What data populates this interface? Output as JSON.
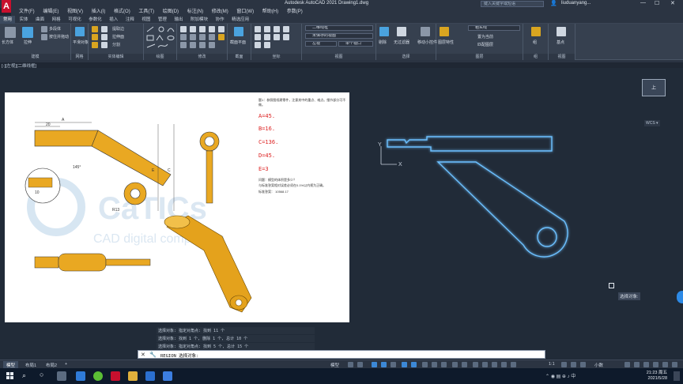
{
  "titlebar": {
    "app_title": "Autodesk AutoCAD 2021     Drawing1.dwg",
    "search_placeholder": "键入关键字或短语",
    "user": "liuduanyang...",
    "min": "—",
    "max": "☐",
    "close": "✕"
  },
  "menu": [
    "文件(F)",
    "编辑(E)",
    "视图(V)",
    "插入(I)",
    "格式(O)",
    "工具(T)",
    "绘图(D)",
    "标注(N)",
    "修改(M)",
    "窗口(W)",
    "帮助(H)",
    "参数(P)"
  ],
  "ribbon_tabs": [
    "常用",
    "实体",
    "曲面",
    "网格",
    "可视化",
    "参数化",
    "插入",
    "注释",
    "视图",
    "管理",
    "输出",
    "附加模块",
    "协作",
    "精选应用"
  ],
  "ribbon": {
    "modeling": {
      "box": "长方体",
      "extrude": "拉伸",
      "polysolid": "多段体",
      "pressmerge": "按住并拖动",
      "label": "建模"
    },
    "mesh": {
      "smooth": "平滑对象",
      "label": "网格"
    },
    "solid_edit": {
      "extract": "提取边",
      "pull": "拉伸面",
      "split": "分割",
      "label": "实体编辑"
    },
    "draw": {
      "label": "绘图"
    },
    "modify": {
      "label": "修改"
    },
    "section": {
      "plane": "截面平面",
      "label": "截面"
    },
    "coords": {
      "label": "坐标"
    },
    "view": {
      "visual_style": "二维线框",
      "saved_view": "未保存的视图",
      "unnamed": "左视",
      "single_viewport": "单个视口",
      "label": "视图"
    },
    "selection": {
      "culling": "剔除",
      "no_filter": "无过滤器",
      "move_gizmo": "移动小控件",
      "label": "选择"
    },
    "layers": {
      "layer_props": "图层特性",
      "current_layer": "粗实线",
      "set_current": "置为当前",
      "match": "匹配图层",
      "label": "图层"
    },
    "groups": {
      "group": "组",
      "label": "组"
    },
    "viewpanel": {
      "base": "基点",
      "label": "视图"
    }
  },
  "viewport_label": "[-][左视][二维线框]",
  "sheet": {
    "note": "题1：参照图纸建零件，注意其中的重点、难点。细节部分可不做。",
    "params": [
      "A=45.",
      "B=16.",
      "C=136.",
      "D=45.",
      "E=3"
    ],
    "q1": "问题：模型的体积是多少？",
    "q2": "与标准答案相对误差必须在0.1%以内视为正确。",
    "answer_label": "标准答案：",
    "answer_value": "10568.17",
    "watermark_big": "CaTICs",
    "watermark_small": "CAD digital competition",
    "dim_labels": [
      "20",
      "A",
      "B",
      "C",
      "D",
      "E",
      "10",
      "145°",
      "R13"
    ]
  },
  "viewcube": {
    "label": "上",
    "wcs": "WCS ▾"
  },
  "axis_labels": {
    "y": "Y",
    "x": "X"
  },
  "tooltip": "选择对象:",
  "command_history": [
    "选择对象: 指定对角点: 找到 11 个",
    "选择对象: 找到 1 个, 删除 1 个, 总计 10 个",
    "选择对象: 指定对角点: 找到 5 个, 总计 15 个"
  ],
  "command_input": "REGION 选择对象:",
  "layout_tabs": [
    "模型",
    "布局1",
    "布局2"
  ],
  "status_model": "模型",
  "status_scale": "1:1",
  "status_units": "小数",
  "clock": {
    "time": "21:23 周五",
    "date": "2021/5/28"
  },
  "colors": {
    "accent": "#2d8ae6",
    "part_gold": "#e0a51a",
    "region_glow": "#4aa3ff"
  }
}
